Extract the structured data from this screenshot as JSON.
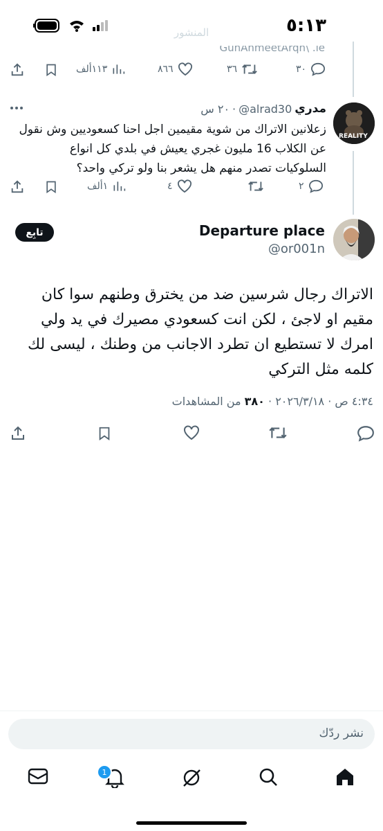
{
  "status_bar": {
    "time": "٥:١٣"
  },
  "ghost_header": "المنشور",
  "ghost_line": "GuhAhmeetArqh\\ .le",
  "top_tweet_actions": {
    "replies": "٣٠",
    "retweets": "٣٦",
    "likes": "٨٦٦",
    "views": "١١٣ألف"
  },
  "reply_tweet": {
    "name": "مدري",
    "handle": "@alrad30",
    "separator": "·",
    "time": "٢٠ س",
    "avatar_text": "REALITY",
    "text": "زعلانين الاتراك من شوية مقيمين اجل احنا كسعوديين وش نقول عن الكلاب 16 مليون غجري يعيش في بلدي كل انواع السلوكيات تصدر منهم هل يشعر بنا ولو تركي واحد؟",
    "actions": {
      "replies": "٢",
      "retweets": "",
      "likes": "٤",
      "views": "١ألف"
    }
  },
  "main_tweet": {
    "name": "Departure place",
    "handle": "@or001n",
    "follow_label": "تابِع",
    "text": "الاتراك رجال شرسين ضد من يخترق وطنهم سوا كان مقيم او لاجئ ، لكن انت كسعودي مصيرك في يد ولي امرك لا تستطيع ان تطرد الاجانب من وطنك ، ليسى لك كلمه مثل التركي",
    "meta_time": "٤:٣٤ ص · ٢٠٢٦/٣/١٨ · ",
    "meta_views_count": "٣٨٠",
    "meta_views_label": " من المشاهدات"
  },
  "reply_box": {
    "placeholder": "نشر ردّك"
  },
  "bottom_nav": {
    "notifications_badge": "1"
  },
  "colors": {
    "text": "#0f1419",
    "muted": "#536471",
    "accent": "#1d9bf0",
    "divider": "#eff3f4"
  }
}
